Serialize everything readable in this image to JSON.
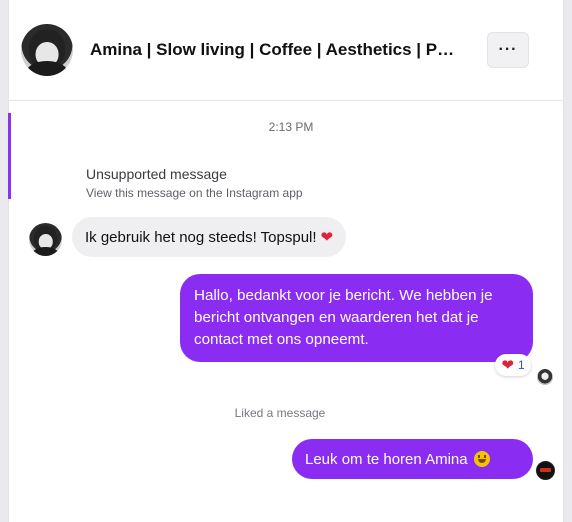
{
  "header": {
    "title": "Amina | Slow living | Coffee | Aesthetics | Photography",
    "more_label": "···"
  },
  "conversation": {
    "timestamp": "2:13 PM",
    "unsupported": {
      "title": "Unsupported message",
      "subtitle": "View this message on the Instagram app"
    },
    "incoming_message": {
      "text": "Ik gebruik het nog steeds! Topspul!",
      "emoji": "❤"
    },
    "outgoing_message_1": {
      "text": "Hallo, bedankt voor je bericht. We hebben je bericht ontvangen en waarderen het dat je contact met ons opneemt.",
      "reaction": {
        "emoji": "❤",
        "count": "1"
      }
    },
    "liked_label": "Liked a message",
    "outgoing_message_2": {
      "text": "Leuk om te horen Amina"
    }
  },
  "colors": {
    "accent": "#8b2cf2",
    "incoming_bubble": "#efeff1",
    "heart": "#e0213a"
  }
}
